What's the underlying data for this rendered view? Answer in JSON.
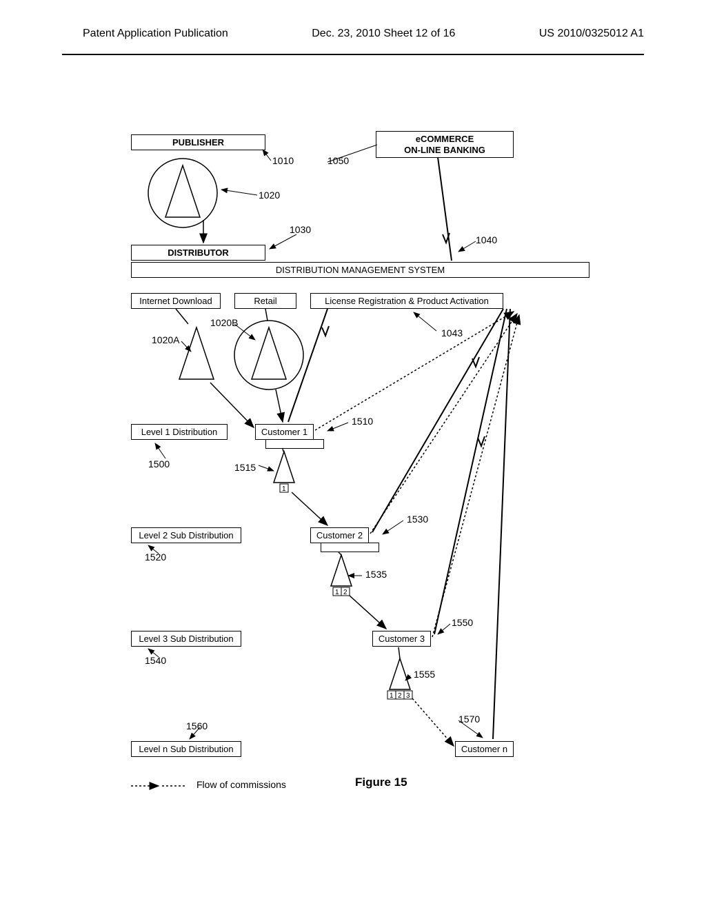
{
  "header": {
    "left": "Patent Application Publication",
    "center": "Dec. 23, 2010   Sheet 12 of 16",
    "right": "US 2010/0325012 A1"
  },
  "boxes": {
    "publisher": "PUBLISHER",
    "ecommerce": "eCOMMERCE\nON-LINE BANKING",
    "distributor": "DISTRIBUTOR",
    "dms": "DISTRIBUTION MANAGEMENT SYSTEM",
    "internet_download": "Internet Download",
    "retail": "Retail",
    "license": "License Registration & Product Activation",
    "level1": "Level 1 Distribution",
    "customer1": "Customer 1",
    "level2": "Level 2 Sub Distribution",
    "customer2": "Customer 2",
    "level3": "Level 3 Sub Distribution",
    "customer3": "Customer 3",
    "leveln": "Level n Sub Distribution",
    "customern": "Customer n"
  },
  "refs": {
    "r1010": "1010",
    "r1020": "1020",
    "r1030": "1030",
    "r1040": "1040",
    "r1050": "1050",
    "r1020A": "1020A",
    "r1020B": "1020B",
    "r1043": "1043",
    "r1500": "1500",
    "r1510": "1510",
    "r1515": "1515",
    "r1520": "1520",
    "r1530": "1530",
    "r1535": "1535",
    "r1540": "1540",
    "r1550": "1550",
    "r1555": "1555",
    "r1560": "1560",
    "r1570": "1570"
  },
  "legend": "Flow of commissions",
  "figure": "Figure 15"
}
